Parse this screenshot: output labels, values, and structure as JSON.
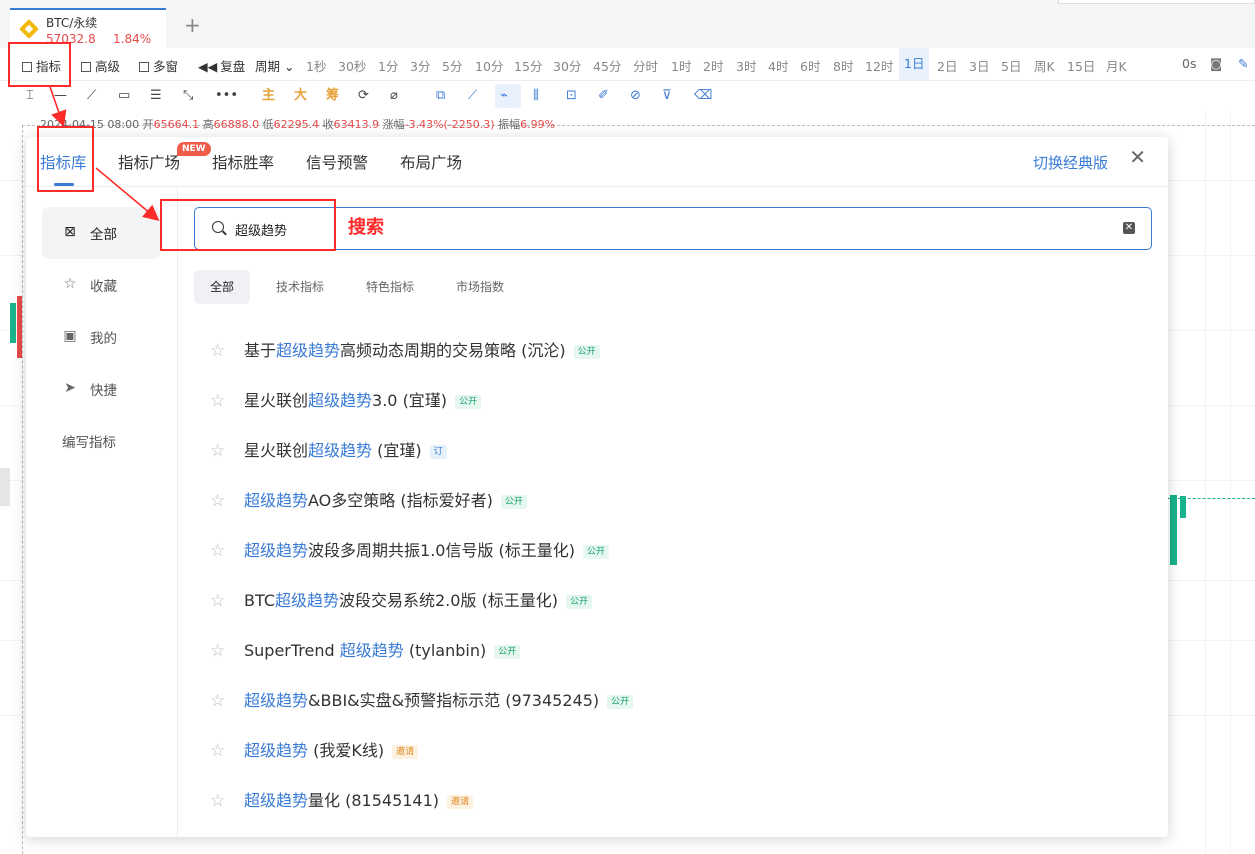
{
  "tab": {
    "symbol": "BTC/永续",
    "price": "57032.8",
    "change": "1.84%",
    "add": "+"
  },
  "toolbar": {
    "indicator": "指标",
    "advanced": "高级",
    "multi": "多窗",
    "replay": "复盘",
    "period": "周期",
    "periods": [
      "1秒",
      "30秒",
      "1分",
      "3分",
      "5分",
      "10分",
      "15分",
      "30分",
      "45分",
      "分时",
      "1时",
      "2时",
      "3时",
      "4时",
      "6时",
      "8时",
      "12时",
      "1日",
      "2日",
      "3日",
      "5日",
      "周K",
      "15日",
      "月K"
    ],
    "active_period": "1日",
    "zero_s": "0s"
  },
  "drawtools": {
    "main": "主",
    "big": "大",
    "chip": "筹",
    "more": "•••"
  },
  "candle_info": {
    "date": "2024-04-15 08:00",
    "open_label": "开",
    "open": "65664.1",
    "high_label": "高",
    "high": "66888.0",
    "low_label": "低",
    "low": "62295.4",
    "close_label": "收",
    "close": "63413.9",
    "chg_label": "涨幅",
    "chg": "-3.43%(-2250.3)",
    "amp_label": "振幅",
    "amp": "6.99%"
  },
  "modal": {
    "tabs": [
      "指标库",
      "指标广场",
      "指标胜率",
      "信号预警",
      "布局广场"
    ],
    "new_badge": "NEW",
    "switch_classic": "切换经典版",
    "close": "✕",
    "sidebar": [
      "全部",
      "收藏",
      "我的",
      "快捷",
      "编写指标"
    ],
    "search_value": "超级趋势",
    "filters": [
      "全部",
      "技术指标",
      "特色指标",
      "市场指数"
    ],
    "results": [
      {
        "pre": "基于",
        "hl": "超级趋势",
        "post": "高频动态周期的交易策略 (沉沦)",
        "tag": "公开",
        "tag_type": "open"
      },
      {
        "pre": "星火联创",
        "hl": "超级趋势",
        "post": "3.0 (宜瑾)",
        "tag": "公开",
        "tag_type": "open"
      },
      {
        "pre": "星火联创",
        "hl": "超级趋势",
        "post": " (宜瑾)",
        "tag": "订",
        "tag_type": "sub"
      },
      {
        "pre": "",
        "hl": "超级趋势",
        "post": "AO多空策略 (指标爱好者)",
        "tag": "公开",
        "tag_type": "open"
      },
      {
        "pre": "",
        "hl": "超级趋势",
        "post": "波段多周期共振1.0信号版 (标王量化)",
        "tag": "公开",
        "tag_type": "open"
      },
      {
        "pre": "BTC",
        "hl": "超级趋势",
        "post": "波段交易系统2.0版 (标王量化)",
        "tag": "公开",
        "tag_type": "open"
      },
      {
        "pre": "SuperTrend ",
        "hl": "超级趋势",
        "post": " (tylanbin)",
        "tag": "公开",
        "tag_type": "open"
      },
      {
        "pre": "",
        "hl": "超级趋势",
        "post": "&BBI&实盘&预警指标示范 (97345245)",
        "tag": "公开",
        "tag_type": "open"
      },
      {
        "pre": "",
        "hl": "超级趋势",
        "post": " (我爱K线)",
        "tag": "邀请",
        "tag_type": "inv"
      },
      {
        "pre": "",
        "hl": "超级趋势",
        "post": "量化 (81545141)",
        "tag": "邀请",
        "tag_type": "inv"
      }
    ]
  },
  "annotation": {
    "search_label": "搜索",
    "color": "#ff2a2a"
  },
  "colors": {
    "accent": "#3a7bd5",
    "down": "#e84a4a",
    "up": "#18b28c"
  }
}
